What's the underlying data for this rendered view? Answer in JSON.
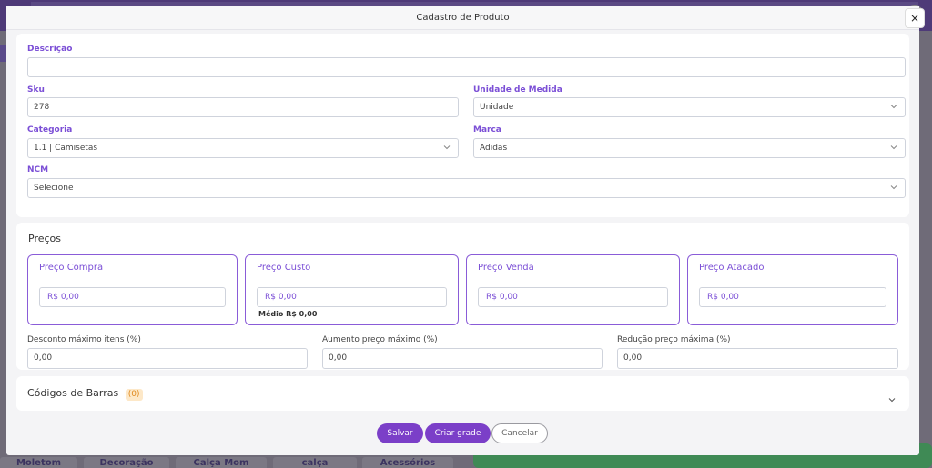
{
  "modal": {
    "title": "Cadastro de Produto",
    "close_label": "×"
  },
  "fields": {
    "descricao": {
      "label": "Descrição",
      "value": ""
    },
    "sku": {
      "label": "Sku",
      "value": "278"
    },
    "unidade": {
      "label": "Unidade de Medida",
      "value": "Unidade"
    },
    "categoria": {
      "label": "Categoria",
      "value": "1.1 | Camisetas"
    },
    "marca": {
      "label": "Marca",
      "value": "Adidas"
    },
    "ncm": {
      "label": "NCM",
      "value": "Selecione"
    }
  },
  "precos": {
    "title": "Preços",
    "boxes": [
      {
        "label": "Preço Compra",
        "value": "R$ 0,00"
      },
      {
        "label": "Preço Custo",
        "value": "R$ 0,00",
        "note": "Médio R$ 0,00"
      },
      {
        "label": "Preço Venda",
        "value": "R$ 0,00"
      },
      {
        "label": "Preço Atacado",
        "value": "R$ 0,00"
      }
    ],
    "desconto": {
      "label": "Desconto máximo itens (%)",
      "value": "0,00"
    },
    "aumento": {
      "label": "Aumento preço máximo (%)",
      "value": "0,00"
    },
    "reducao": {
      "label": "Redução preço máxima (%)",
      "value": "0,00"
    }
  },
  "barcodes": {
    "title": "Códigos de Barras",
    "count": "(0)"
  },
  "buttons": {
    "save": "Salvar",
    "grade": "Criar grade",
    "cancel": "Cancelar"
  },
  "background": {
    "categories": [
      "Moletom",
      "Decoração",
      "Calça Mom",
      "calça",
      "Acessórios"
    ]
  },
  "colors": {
    "accent": "#7b3fc8",
    "label": "#7b4fd6",
    "badge": "#e08a1e"
  },
  "icons": {
    "close": "close-icon",
    "dropdown": "chevron-down-icon",
    "expand": "chevron-down-icon"
  }
}
